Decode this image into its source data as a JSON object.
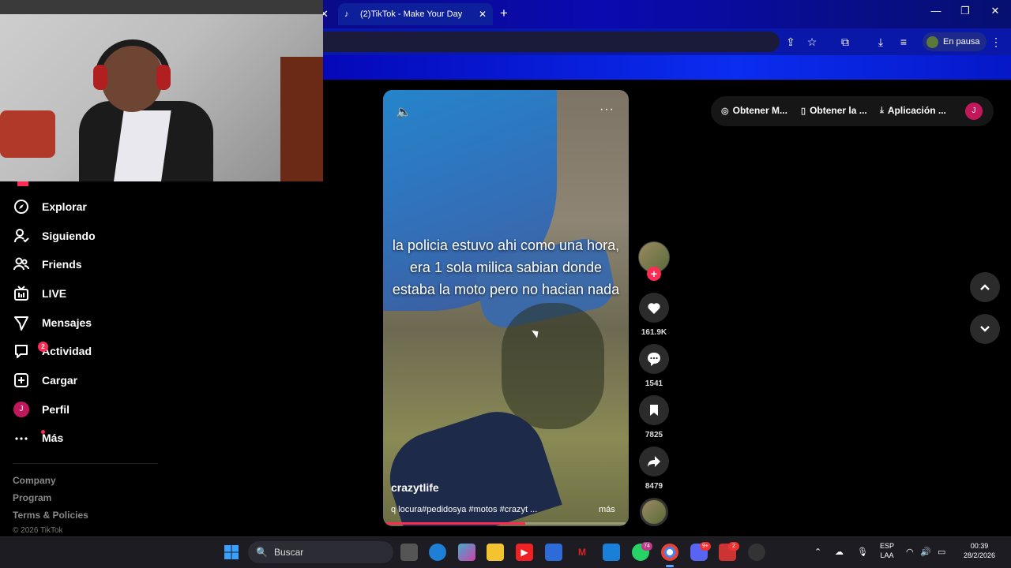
{
  "browser": {
    "tab_title": "(2)TikTok - Make Your Day",
    "new_tab": "+",
    "tab_close": "✕",
    "profile_status": "En pausa"
  },
  "sidebar": {
    "items": [
      {
        "label": "Explorar",
        "icon": "compass-icon"
      },
      {
        "label": "Siguiendo",
        "icon": "user-follow-icon"
      },
      {
        "label": "Friends",
        "icon": "friends-icon"
      },
      {
        "label": "LIVE",
        "icon": "live-tv-icon"
      },
      {
        "label": "Mensajes",
        "icon": "send-icon"
      },
      {
        "label": "Actividad",
        "icon": "activity-icon",
        "badge": "2"
      },
      {
        "label": "Cargar",
        "icon": "upload-plus-icon"
      },
      {
        "label": "Perfil",
        "icon": "profile-avatar",
        "avatar_letter": "J"
      },
      {
        "label": "Más",
        "icon": "more-dots-icon"
      }
    ],
    "footer": {
      "company": "Company",
      "program": "Program",
      "terms": "Terms & Policies",
      "copyright": "© 2026 TikTok"
    }
  },
  "video": {
    "overlay_text": "la policia estuvo ahi como una hora, era 1 sola milica sabian donde estaba la moto pero no hacian nada",
    "author": "crazytlife",
    "caption": "q locura#pedidosya #motos #crazyt ...",
    "more_label": "más",
    "progress": 0.58
  },
  "actions": {
    "likes": "161.9K",
    "comments": "1541",
    "saves": "7825",
    "shares": "8479"
  },
  "top_pills": {
    "coins": "Obtener M...",
    "app": "Obtener la ...",
    "download": "Aplicación ...",
    "avatar_letter": "J"
  },
  "taskbar": {
    "search_placeholder": "Buscar",
    "whatsapp_badge": "74",
    "discord_badge": "9+",
    "app_badge": "2",
    "lang_top": "ESP",
    "lang_bottom": "LAA",
    "time": "00:39",
    "date": "28/2/2026"
  },
  "colors": {
    "accent": "#fe2c55",
    "browser_blue": "#0a2df0",
    "avatar_pink": "#c2185b"
  }
}
